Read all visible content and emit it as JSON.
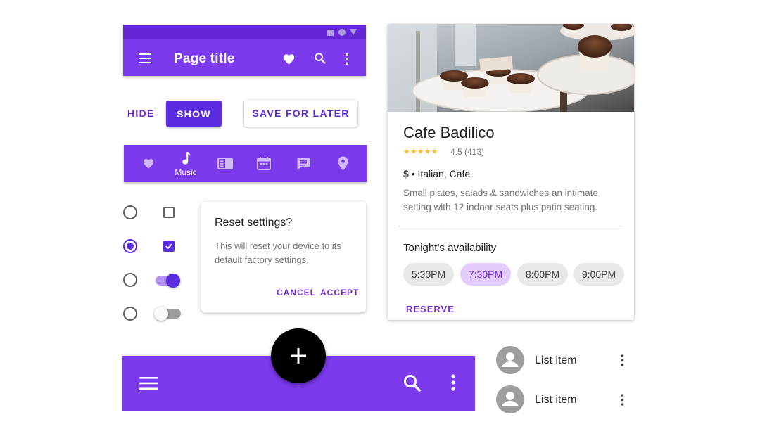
{
  "top_app_bar": {
    "title": "Page title",
    "icons": [
      "menu-icon",
      "heart-icon",
      "search-icon",
      "more-vert-icon"
    ],
    "status_icons": [
      "square",
      "circle",
      "triangle"
    ]
  },
  "buttons": {
    "text_label": "HIDE",
    "contained_label": "SHOW",
    "outlined_label": "SAVE FOR LATER"
  },
  "bottom_nav": {
    "items": [
      {
        "icon": "heart-icon",
        "label": ""
      },
      {
        "icon": "music-note-icon",
        "label": "Music"
      },
      {
        "icon": "book-icon",
        "label": ""
      },
      {
        "icon": "calendar-icon",
        "label": ""
      },
      {
        "icon": "message-icon",
        "label": ""
      },
      {
        "icon": "location-icon",
        "label": ""
      }
    ]
  },
  "selection_controls": {
    "radios": [
      false,
      true,
      false,
      false
    ],
    "checkboxes": [
      false,
      true
    ],
    "switches": [
      true,
      false
    ]
  },
  "dialog": {
    "title": "Reset settings?",
    "body": "This will reset your device to its default factory settings.",
    "cancel_label": "CANCEL",
    "accept_label": "ACCEPT"
  },
  "card": {
    "title": "Cafe Badilico",
    "stars": "★★★★★",
    "rating": "4.5 (413)",
    "price_category": "$ • Italian, Cafe",
    "description": "Small plates, salads & sandwiches an intimate setting with 12 indoor seats plus patio seating.",
    "availability_heading": "Tonight’s availability",
    "times": [
      "5:30PM",
      "7:30PM",
      "8:00PM",
      "9:00PM"
    ],
    "selected_time": "7:30PM",
    "reserve_label": "RESERVE"
  },
  "bottom_app_bar": {
    "icons": [
      "menu-icon",
      "search-icon",
      "more-vert-icon"
    ],
    "fab_icon": "add-icon"
  },
  "list": {
    "items": [
      {
        "label": "List item"
      },
      {
        "label": "List item"
      }
    ]
  },
  "colors": {
    "primary": "#7c3aed",
    "primary_dark": "#6427d6",
    "button": "#5b2be0",
    "accent_text": "#6d28d9",
    "chip_selected": "#e3ccfb",
    "star": "#fbc02d"
  }
}
